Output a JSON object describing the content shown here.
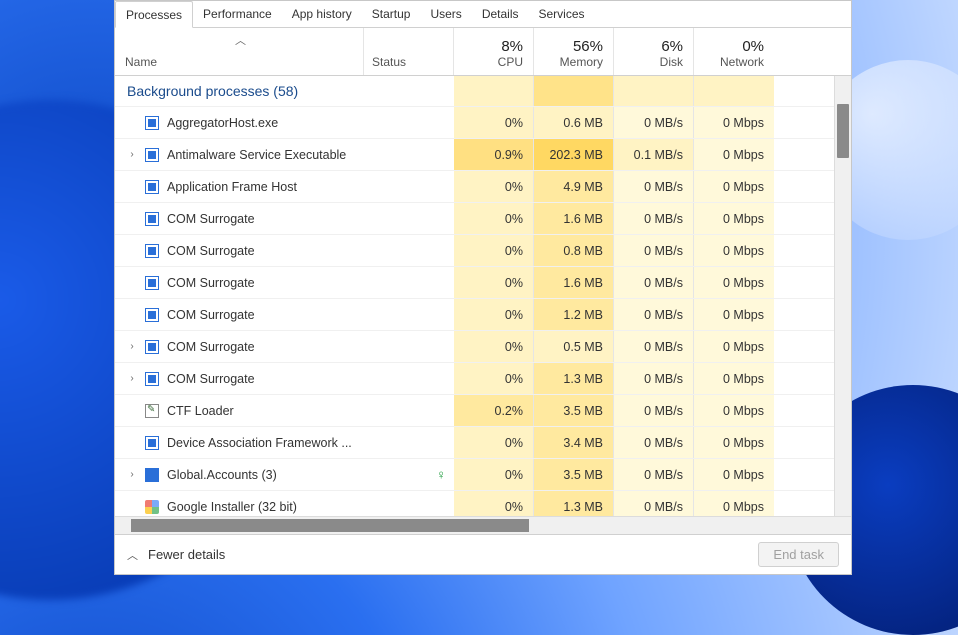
{
  "tabs": [
    "Processes",
    "Performance",
    "App history",
    "Startup",
    "Users",
    "Details",
    "Services"
  ],
  "active_tab": 0,
  "columns": {
    "name": "Name",
    "status": "Status",
    "metrics": [
      {
        "pct": "8%",
        "label": "CPU"
      },
      {
        "pct": "56%",
        "label": "Memory"
      },
      {
        "pct": "6%",
        "label": "Disk"
      },
      {
        "pct": "0%",
        "label": "Network"
      }
    ]
  },
  "group_header": "Background processes (58)",
  "processes": [
    {
      "expandable": false,
      "icon": "frame",
      "name": "AggregatorHost.exe",
      "leaf": false,
      "cpu": "0%",
      "cpu_h": 1,
      "mem": "0.6 MB",
      "mem_h": 1,
      "disk": "0 MB/s",
      "disk_h": 0,
      "net": "0 Mbps",
      "net_h": 0
    },
    {
      "expandable": true,
      "icon": "frame",
      "name": "Antimalware Service Executable",
      "leaf": false,
      "cpu": "0.9%",
      "cpu_h": 3,
      "mem": "202.3 MB",
      "mem_h": 4,
      "disk": "0.1 MB/s",
      "disk_h": 1,
      "net": "0 Mbps",
      "net_h": 0
    },
    {
      "expandable": false,
      "icon": "frame",
      "name": "Application Frame Host",
      "leaf": false,
      "cpu": "0%",
      "cpu_h": 1,
      "mem": "4.9 MB",
      "mem_h": 2,
      "disk": "0 MB/s",
      "disk_h": 0,
      "net": "0 Mbps",
      "net_h": 0
    },
    {
      "expandable": false,
      "icon": "frame",
      "name": "COM Surrogate",
      "leaf": false,
      "cpu": "0%",
      "cpu_h": 1,
      "mem": "1.6 MB",
      "mem_h": 2,
      "disk": "0 MB/s",
      "disk_h": 0,
      "net": "0 Mbps",
      "net_h": 0
    },
    {
      "expandable": false,
      "icon": "frame",
      "name": "COM Surrogate",
      "leaf": false,
      "cpu": "0%",
      "cpu_h": 1,
      "mem": "0.8 MB",
      "mem_h": 2,
      "disk": "0 MB/s",
      "disk_h": 0,
      "net": "0 Mbps",
      "net_h": 0
    },
    {
      "expandable": false,
      "icon": "frame",
      "name": "COM Surrogate",
      "leaf": false,
      "cpu": "0%",
      "cpu_h": 1,
      "mem": "1.6 MB",
      "mem_h": 2,
      "disk": "0 MB/s",
      "disk_h": 0,
      "net": "0 Mbps",
      "net_h": 0
    },
    {
      "expandable": false,
      "icon": "frame",
      "name": "COM Surrogate",
      "leaf": false,
      "cpu": "0%",
      "cpu_h": 1,
      "mem": "1.2 MB",
      "mem_h": 2,
      "disk": "0 MB/s",
      "disk_h": 0,
      "net": "0 Mbps",
      "net_h": 0
    },
    {
      "expandable": true,
      "icon": "frame",
      "name": "COM Surrogate",
      "leaf": false,
      "cpu": "0%",
      "cpu_h": 1,
      "mem": "0.5 MB",
      "mem_h": 1,
      "disk": "0 MB/s",
      "disk_h": 0,
      "net": "0 Mbps",
      "net_h": 0
    },
    {
      "expandable": true,
      "icon": "frame",
      "name": "COM Surrogate",
      "leaf": false,
      "cpu": "0%",
      "cpu_h": 1,
      "mem": "1.3 MB",
      "mem_h": 2,
      "disk": "0 MB/s",
      "disk_h": 0,
      "net": "0 Mbps",
      "net_h": 0
    },
    {
      "expandable": false,
      "icon": "ctf",
      "name": "CTF Loader",
      "leaf": false,
      "cpu": "0.2%",
      "cpu_h": 2,
      "mem": "3.5 MB",
      "mem_h": 2,
      "disk": "0 MB/s",
      "disk_h": 0,
      "net": "0 Mbps",
      "net_h": 0
    },
    {
      "expandable": false,
      "icon": "frame",
      "name": "Device Association Framework ...",
      "leaf": false,
      "cpu": "0%",
      "cpu_h": 1,
      "mem": "3.4 MB",
      "mem_h": 2,
      "disk": "0 MB/s",
      "disk_h": 0,
      "net": "0 Mbps",
      "net_h": 0
    },
    {
      "expandable": true,
      "icon": "global",
      "name": "Global.Accounts (3)",
      "leaf": true,
      "cpu": "0%",
      "cpu_h": 1,
      "mem": "3.5 MB",
      "mem_h": 2,
      "disk": "0 MB/s",
      "disk_h": 0,
      "net": "0 Mbps",
      "net_h": 0
    },
    {
      "expandable": false,
      "icon": "google",
      "name": "Google Installer (32 bit)",
      "leaf": false,
      "cpu": "0%",
      "cpu_h": 1,
      "mem": "1.3 MB",
      "mem_h": 2,
      "disk": "0 MB/s",
      "disk_h": 0,
      "net": "0 Mbps",
      "net_h": 0
    }
  ],
  "footer": {
    "details_toggle": "Fewer details",
    "end_task": "End task"
  }
}
